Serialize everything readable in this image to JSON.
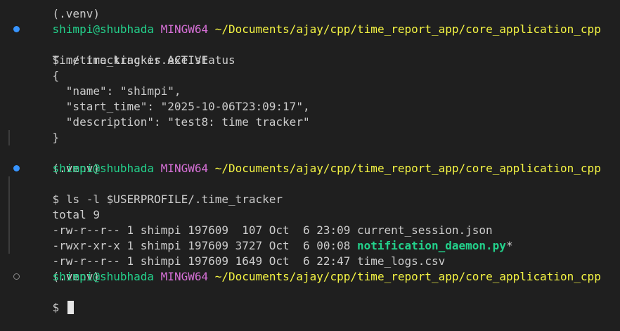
{
  "terminal": {
    "lines": {
      "l0": {
        "text": "(.venv)"
      },
      "l1": {
        "user": "shimpi@shubhada",
        "system": "MINGW64",
        "path": "~/Documents/ajay/cpp/time_report_app/core_application_cpp"
      },
      "l2": {
        "prompt": "$",
        "command": "./time_tracker.exe status"
      },
      "l3": {
        "text": "Time tracking is ACTIVE"
      },
      "l4": {
        "text": "{"
      },
      "l5": {
        "text": "  \"name\": \"shimpi\","
      },
      "l6": {
        "text": "  \"start_time\": \"2025-10-06T23:09:17\","
      },
      "l7": {
        "text": "  \"description\": \"test8: time tracker\""
      },
      "l8": {
        "text": "}"
      },
      "l9": {
        "text": "(.venv)"
      },
      "l10": {
        "user": "shimpi@shubhada",
        "system": "MINGW64",
        "path": "~/Documents/ajay/cpp/time_report_app/core_application_cpp"
      },
      "l11": {
        "prompt": "$",
        "command": "ls -l $USERPROFILE/.time_tracker"
      },
      "l12": {
        "text": "total 9"
      },
      "l13": {
        "text": "-rw-r--r-- 1 shimpi 197609  107 Oct  6 23:09 current_session.json"
      },
      "l14": {
        "prefix": "-rwxr-xr-x 1 shimpi 197609 3727 Oct  6 00:08 ",
        "filename": "notification_daemon.py",
        "suffix": "*"
      },
      "l15": {
        "text": "-rw-r--r-- 1 shimpi 197609 1649 Oct  6 22:47 time_logs.csv"
      },
      "l16": {
        "text": "(.venv)"
      },
      "l17": {
        "user": "shimpi@shubhada",
        "system": "MINGW64",
        "path": "~/Documents/ajay/cpp/time_report_app/core_application_cpp"
      },
      "l18": {
        "prompt": "$"
      }
    }
  },
  "colors": {
    "background": "#1f1f1f",
    "text": "#cccccc",
    "user": "#23d18b",
    "system": "#d670d6",
    "path": "#f5f543",
    "decoration_success": "#3794ff",
    "decoration_pending": "#8a8a8a"
  }
}
